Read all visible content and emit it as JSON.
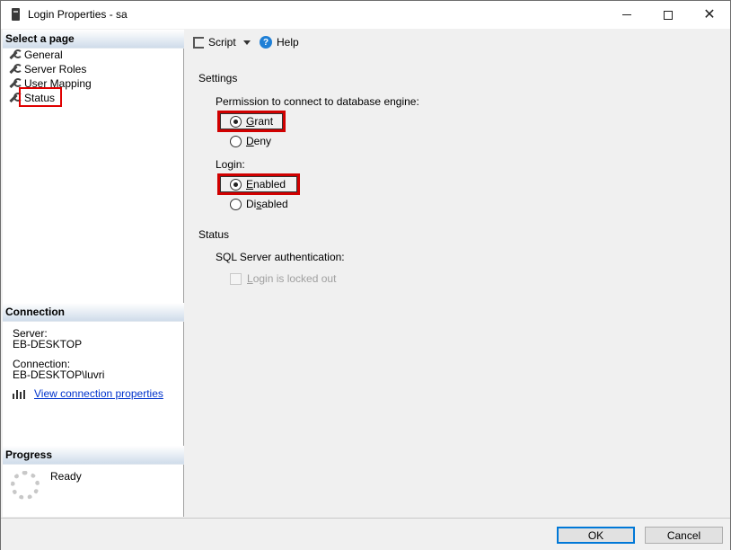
{
  "window": {
    "title": "Login Properties - sa"
  },
  "left_panel": {
    "select_page_header": "Select a page",
    "pages": [
      "General",
      "Server Roles",
      "User Mapping",
      "Status"
    ],
    "connection_header": "Connection",
    "server_label": "Server:",
    "server_value": "EB-DESKTOP",
    "connection_label": "Connection:",
    "connection_value": "EB-DESKTOP\\luvri",
    "view_connection_link": "View connection properties",
    "progress_header": "Progress",
    "progress_status": "Ready"
  },
  "toolbar": {
    "script_label": "Script",
    "help_label": "Help"
  },
  "settings": {
    "header": "Settings",
    "permission_label": "Permission to connect to database engine:",
    "grant": {
      "access_key": "G",
      "rest": "rant",
      "selected": true
    },
    "deny": {
      "access_key": "D",
      "rest": "eny",
      "selected": false
    },
    "login_label": "Login:",
    "enabled": {
      "access_key": "E",
      "rest": "nabled",
      "selected": true
    },
    "disabled": {
      "prefix": "Di",
      "access_key": "s",
      "rest": "abled",
      "selected": false
    }
  },
  "status": {
    "header": "Status",
    "auth_label": "SQL Server authentication:",
    "locked_out": {
      "prefix": "",
      "access_key": "L",
      "rest": "ogin is locked out",
      "checked": false,
      "enabled": false
    }
  },
  "footer": {
    "ok_label": "OK",
    "cancel_label": "Cancel"
  },
  "colors": {
    "highlight": "#e00000",
    "link": "#0033cc",
    "header_gradient_end": "#cfdcea"
  }
}
